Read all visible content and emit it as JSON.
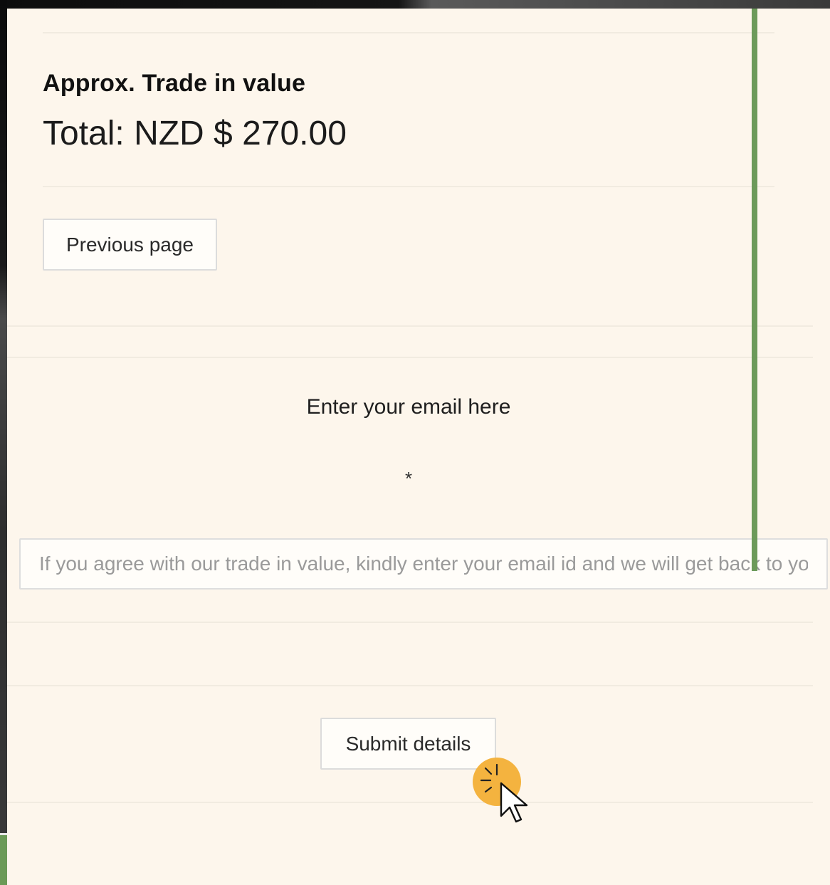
{
  "trade_in": {
    "heading": "Approx. Trade in value",
    "total": "Total: NZD $ 270.00"
  },
  "navigation": {
    "previous_label": "Previous page"
  },
  "email_section": {
    "label": "Enter your email here",
    "required_marker": "*",
    "placeholder": "If you agree with our trade in value, kindly enter your email id and we will get back to you",
    "value": ""
  },
  "actions": {
    "submit_label": "Submit details"
  },
  "colors": {
    "panel_background": "#fdf6ec",
    "accent_green": "#6c9a5a",
    "click_highlight": "#f4b33f"
  },
  "icons": {
    "cursor": "pointer-click-icon"
  }
}
